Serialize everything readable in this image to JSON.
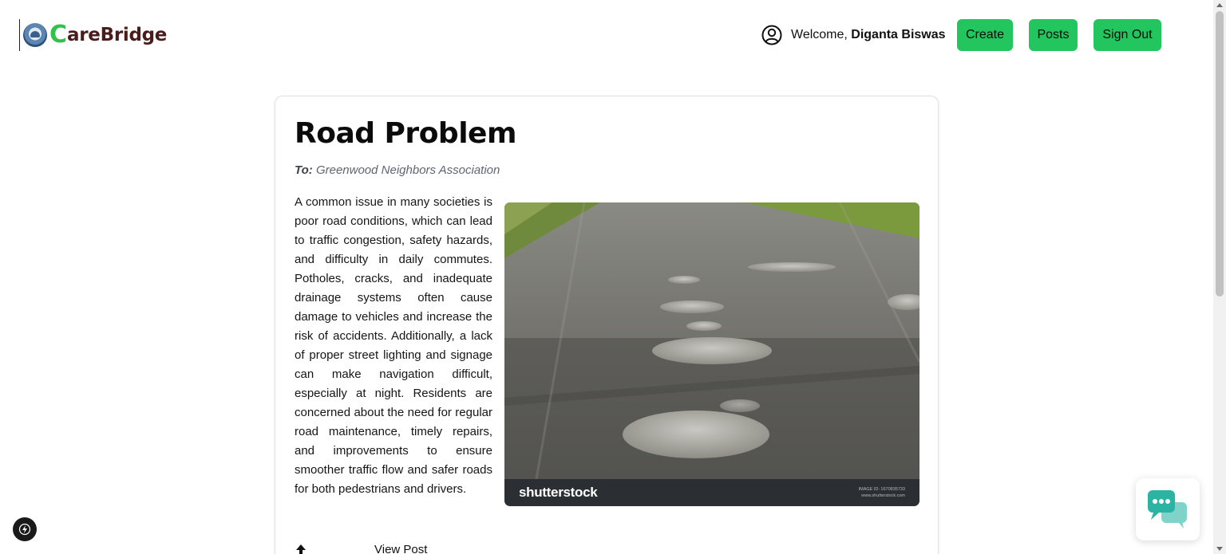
{
  "header": {
    "logo_letter": "C",
    "logo_rest": "areBridge",
    "welcome_prefix": "Welcome, ",
    "user_name": "Diganta Biswas",
    "buttons": {
      "create": "Create",
      "posts": "Posts",
      "signout": "Sign Out"
    }
  },
  "post": {
    "title": "Road Problem",
    "to_label": "To:",
    "to_value": "Greenwood Neighbors Association",
    "body": "A common issue in many societies is poor road conditions, which can lead to traffic congestion, safety hazards, and difficulty in daily commutes. Potholes, cracks, and inadequate drainage systems often cause damage to vehicles and increase the risk of accidents. Additionally, a lack of proper street lighting and signage can make navigation difficult, especially at night. Residents are concerned about the need for regular road maintenance, timely repairs, and improvements to ensure smoother traffic flow and safer roads for both pedestrians and drivers.",
    "image": {
      "watermark_brand": "shutterstock",
      "image_id_line": "IMAGE ID: 1670835733",
      "site_line": "www.shutterstock.com"
    },
    "view_post_label": "View Post"
  },
  "icons": {
    "user": "user-circle-icon",
    "upvote": "arrow-up-icon",
    "bolt": "lightning-bolt-icon",
    "chat": "chat-bubbles-icon"
  },
  "colors": {
    "accent": "#22c55e",
    "logo_green": "#2fc24c",
    "logo_maroon": "#4a1d1d",
    "chat_teal": "#2bb3a3"
  }
}
